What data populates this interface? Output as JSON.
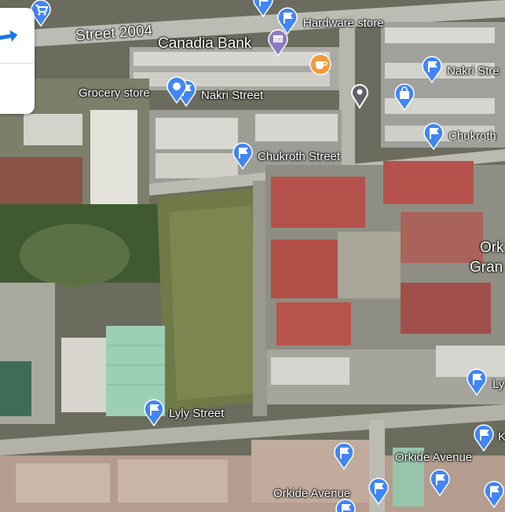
{
  "map": {
    "place_labels": [
      {
        "key": "street2004",
        "text": "Street 2004"
      },
      {
        "key": "canadia",
        "text": "Canadia Bank"
      },
      {
        "key": "hardware",
        "text": "Hardware store"
      },
      {
        "key": "grocery",
        "text": "Grocery store"
      },
      {
        "key": "nakri1",
        "text": "Nakri Street"
      },
      {
        "key": "nakri2",
        "text": "Nakri Stre"
      },
      {
        "key": "chukroth1",
        "text": "Chukroth Street"
      },
      {
        "key": "chukroth2",
        "text": "Chukroth"
      },
      {
        "key": "orkide_gran1",
        "text": "Ork"
      },
      {
        "key": "orkide_gran2",
        "text": "Gran"
      },
      {
        "key": "lyly1",
        "text": "Lyly Street"
      },
      {
        "key": "lyly2",
        "text": "Ly"
      },
      {
        "key": "k_cut",
        "text": "K"
      },
      {
        "key": "orkide_ave1",
        "text": "Orkide Avenue"
      },
      {
        "key": "orkide_ave2",
        "text": "Orkide Avenue"
      }
    ],
    "bank_badge": "100",
    "colors": {
      "pin_blue": "#4285f4",
      "cafe_orange": "#f29a3a",
      "bank_purple": "#8e7cc3",
      "field_green": "#6f7a48",
      "roof_red": "#b4524b",
      "greenhouse": "#9ccfb4"
    }
  },
  "controls": {
    "directions_icon": "directions-arrow-icon"
  }
}
